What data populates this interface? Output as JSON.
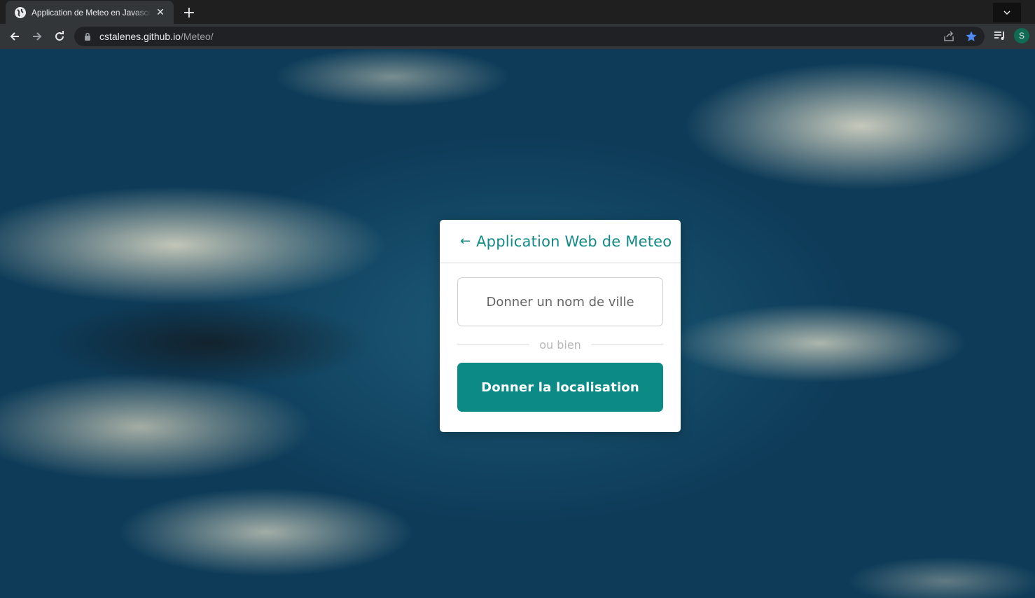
{
  "browser": {
    "tab_title": "Application de Meteo en Javascript",
    "tab_close_icon": "close-icon",
    "new_tab_label": "+",
    "url_host": "cstalenes.github.io",
    "url_path": "/Meteo/",
    "profile_initial": "S",
    "colors": {
      "tab_strip": "#1f1f1f",
      "toolbar": "#323639",
      "bookmark_star": "#4c8bf5",
      "avatar": "#0f6b53"
    }
  },
  "card": {
    "back_icon": "←",
    "title": "Application Web de Meteo",
    "city_placeholder": "Donner un nom de ville",
    "separator_text": "ou bien",
    "location_button_label": "Donner la localisation",
    "colors": {
      "accent": "#0c8a85",
      "title": "#128a86"
    }
  }
}
